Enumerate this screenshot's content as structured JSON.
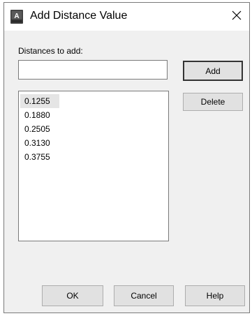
{
  "window": {
    "title": "Add Distance Value",
    "close_label": "✕",
    "app_icon": "autocad-icon"
  },
  "form": {
    "distances_label": "Distances to add:",
    "input_value": ""
  },
  "buttons": {
    "add": "Add",
    "delete": "Delete",
    "ok": "OK",
    "cancel": "Cancel",
    "help": "Help"
  },
  "list": {
    "items": [
      "0.1255",
      "0.1880",
      "0.2505",
      "0.3130",
      "0.3755"
    ],
    "selected_index": 0
  },
  "colors": {
    "dialog_bg": "#f0f0f0",
    "button_bg": "#e1e1e1",
    "selection_bg": "#e5e5e5",
    "icon_dark": "#3c3c3c"
  }
}
